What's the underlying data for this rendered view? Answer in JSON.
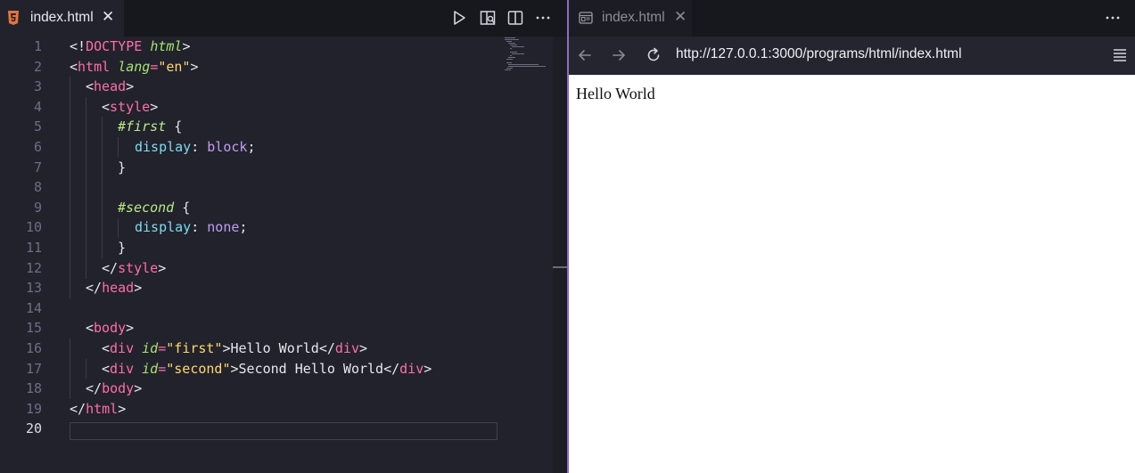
{
  "editor": {
    "tab_title": "index.html",
    "tab_close": "✕",
    "toolbar_icons": [
      "run-icon",
      "open-preview-icon",
      "split-editor-icon",
      "more-actions-icon"
    ],
    "line_numbers": [
      "1",
      "2",
      "3",
      "4",
      "5",
      "6",
      "7",
      "8",
      "9",
      "10",
      "11",
      "12",
      "13",
      "14",
      "15",
      "16",
      "17",
      "18",
      "19",
      "20"
    ],
    "active_line": "20",
    "code": {
      "l1": [
        "<!",
        "DOCTYPE",
        " ",
        "html",
        ">"
      ],
      "l2": [
        "<",
        "html",
        " ",
        "lang",
        "=",
        "\"en\"",
        ">"
      ],
      "l3": [
        "<",
        "head",
        ">"
      ],
      "l4": [
        "<",
        "style",
        ">"
      ],
      "l5": [
        "#first",
        " {"
      ],
      "l6": [
        "display",
        ": ",
        "block",
        ";"
      ],
      "l7": [
        "}"
      ],
      "l9": [
        "#second",
        " {"
      ],
      "l10": [
        "display",
        ": ",
        "none",
        ";"
      ],
      "l11": [
        "}"
      ],
      "l12": [
        "</",
        "style",
        ">"
      ],
      "l13": [
        "</",
        "head",
        ">"
      ],
      "l15": [
        "<",
        "body",
        ">"
      ],
      "l16": [
        "<",
        "div",
        " ",
        "id",
        "=",
        "\"first\"",
        ">Hello World</",
        "div",
        ">"
      ],
      "l17": [
        "<",
        "div",
        " ",
        "id",
        "=",
        "\"second\"",
        ">Second Hello World</",
        "div",
        ">"
      ],
      "l18": [
        "</",
        "body",
        ">"
      ],
      "l19": [
        "</",
        "html",
        ">"
      ]
    }
  },
  "browser": {
    "tab_title": "index.html",
    "tab_close": "✕",
    "url": "http://127.0.0.1:3000/programs/html/index.html",
    "content_text": "Hello World"
  },
  "colors": {
    "accent_divider": "#8a6fc4",
    "tag": "#ff6ea7",
    "attribute": "#a6e36f",
    "string": "#ffd86b",
    "css_property": "#7ddcf0",
    "css_value": "#c29cf5"
  }
}
